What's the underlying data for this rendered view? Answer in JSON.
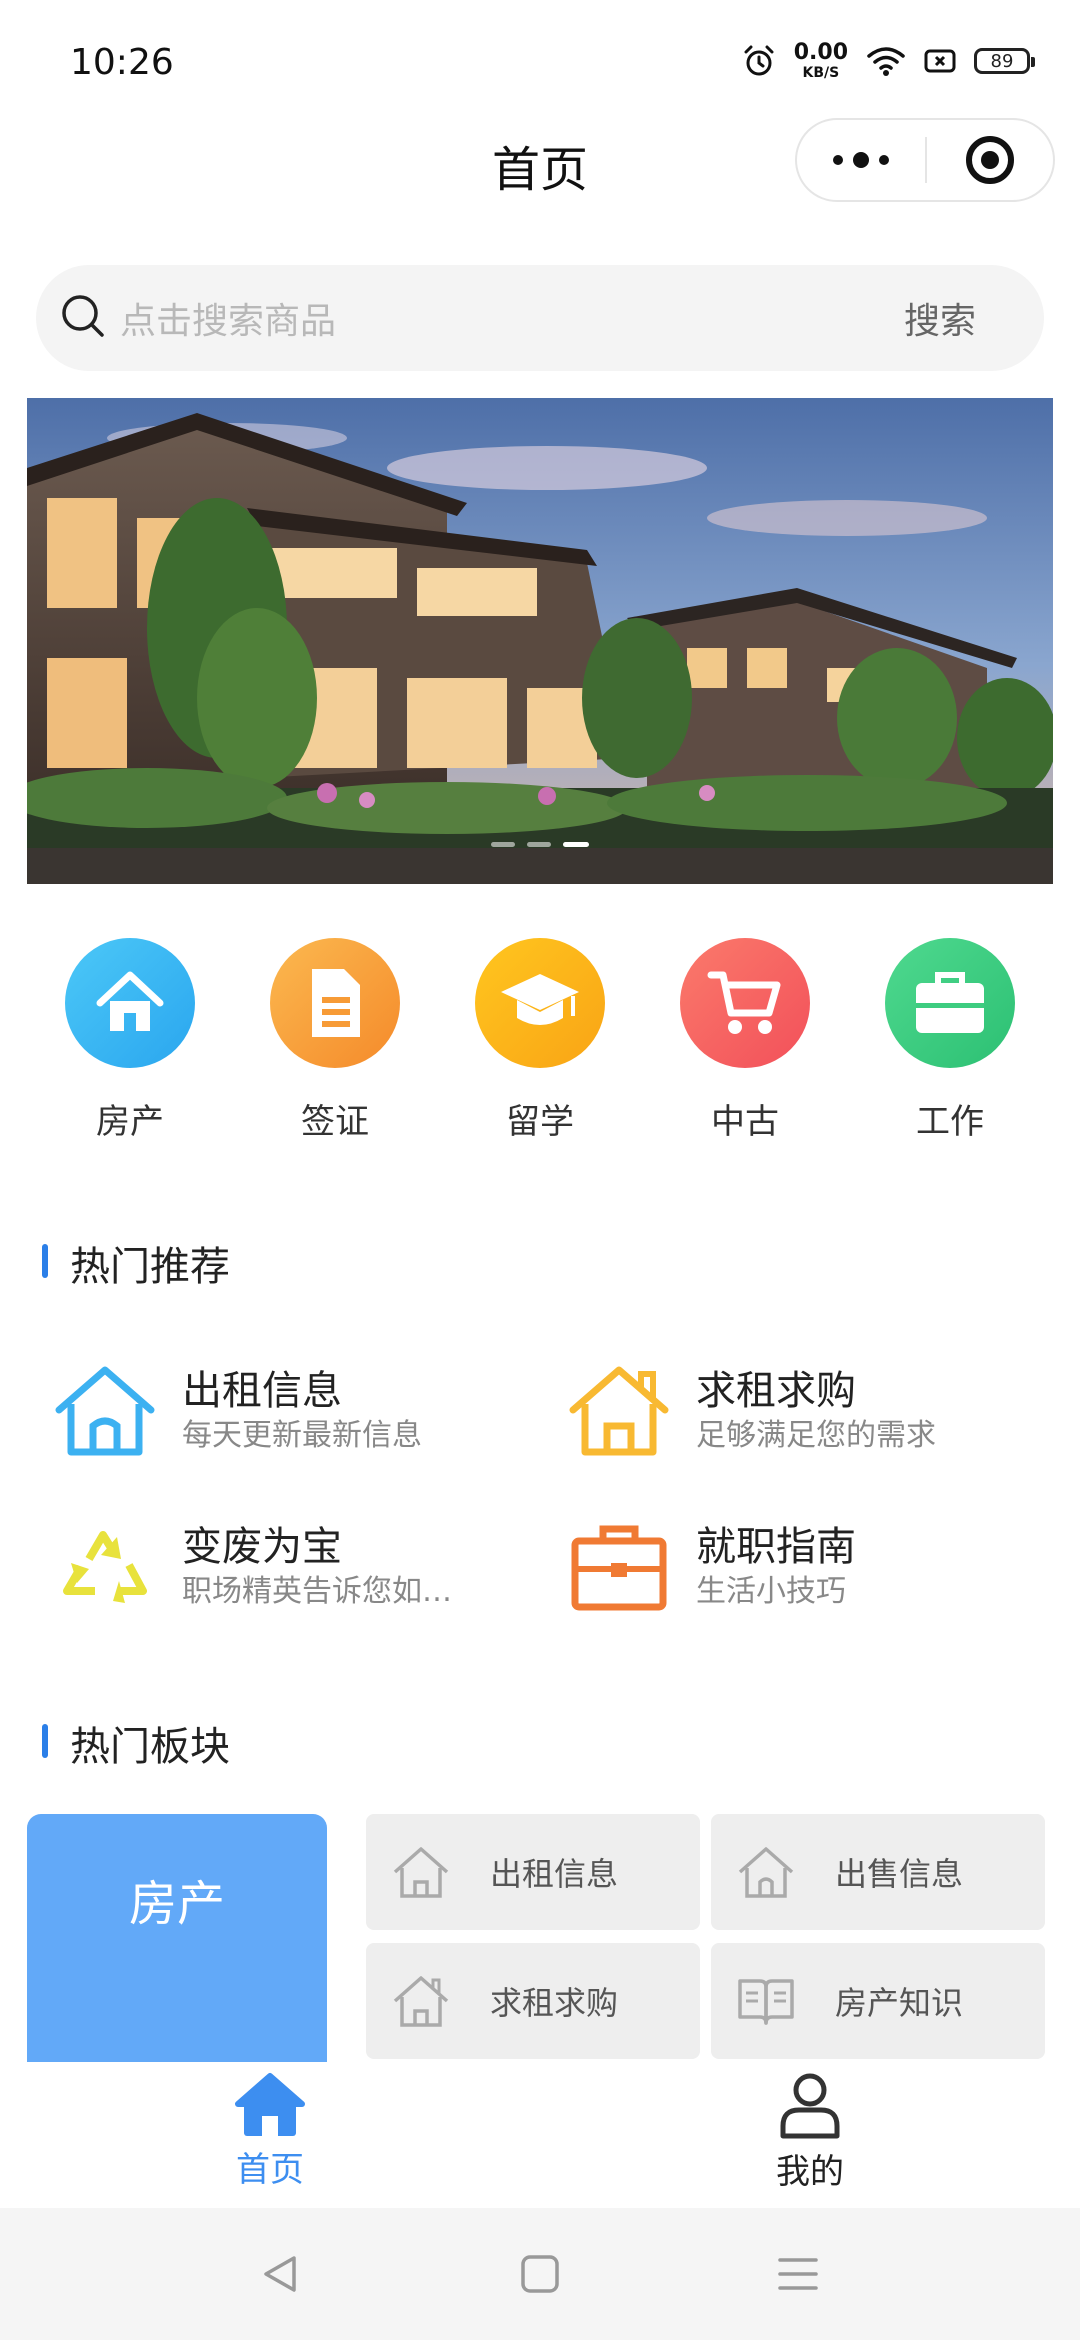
{
  "status_bar": {
    "time": "10:26",
    "net_speed_value": "0.00",
    "net_speed_unit": "KB/S",
    "battery": "89"
  },
  "nav": {
    "title": "首页"
  },
  "search": {
    "placeholder": "点击搜索商品",
    "button": "搜索"
  },
  "banner": {
    "slide_count": 3,
    "active_slide": 3
  },
  "categories": [
    {
      "label": "房产",
      "icon": "house-icon",
      "color": "#3db7f2"
    },
    {
      "label": "签证",
      "icon": "document-icon",
      "color": "#f9a23a"
    },
    {
      "label": "留学",
      "icon": "graduation-cap-icon",
      "color": "#fbb319"
    },
    {
      "label": "中古",
      "icon": "cart-icon",
      "color": "#f76763"
    },
    {
      "label": "工作",
      "icon": "briefcase-icon",
      "color": "#3fcf82"
    }
  ],
  "hot_recommend": {
    "title": "热门推荐",
    "items": [
      {
        "title": "出租信息",
        "subtitle": "每天更新最新信息",
        "icon": "house-outline-icon",
        "color": "#3cb1f1"
      },
      {
        "title": "求租求购",
        "subtitle": "足够满足您的需求",
        "icon": "house-outline-icon",
        "color": "#f8b932"
      },
      {
        "title": "变废为宝",
        "subtitle": "职场精英告诉您如…",
        "icon": "recycle-icon",
        "color": "#e8e23c"
      },
      {
        "title": "就职指南",
        "subtitle": "生活小技巧",
        "icon": "briefcase-outline-icon",
        "color": "#f07a33"
      }
    ]
  },
  "hot_blocks": {
    "title": "热门板块",
    "main_label": "房产",
    "main_color": "#62a9f8",
    "items": [
      {
        "label": "出租信息",
        "icon": "house-outline-icon"
      },
      {
        "label": "出售信息",
        "icon": "house-outline-icon"
      },
      {
        "label": "求租求购",
        "icon": "house-outline-icon"
      },
      {
        "label": "房产知识",
        "icon": "book-icon"
      }
    ]
  },
  "tabbar": {
    "items": [
      {
        "label": "首页",
        "icon": "home-icon",
        "active": true,
        "color": "#3d8ef0"
      },
      {
        "label": "我的",
        "icon": "person-icon",
        "active": false,
        "color": "#222222"
      }
    ]
  }
}
